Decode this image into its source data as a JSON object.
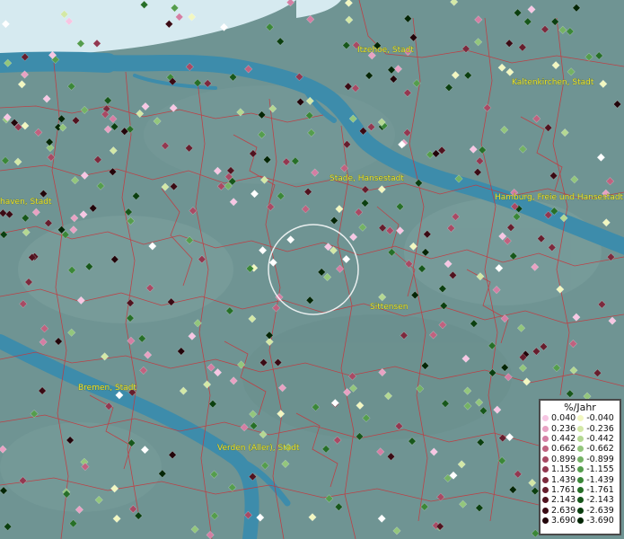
{
  "map": {
    "colors": {
      "land": "#6f9493",
      "water": "#3d8cab",
      "sea": "#d6eaf0",
      "border": "#c8343a",
      "marker_ring": "#ffffff",
      "label": "#e8e23a"
    },
    "cities": [
      {
        "name": "Itzehoe, Stadt"
      },
      {
        "name": "Kaltenkirchen, Stadt"
      },
      {
        "name": "Stade, Hansestadt"
      },
      {
        "name": "Hamburg, Freie und Hansestadt"
      },
      {
        "name": "haven, Stadt"
      },
      {
        "name": "Sittensen"
      },
      {
        "name": "Bremen, Stadt"
      },
      {
        "name": "Verden (Aller), Stadt"
      }
    ]
  },
  "legend": {
    "title": "%/Jahr",
    "positive": [
      {
        "label": "0.040",
        "color": "#f7c6e3"
      },
      {
        "label": "0.236",
        "color": "#e8a2c3"
      },
      {
        "label": "0.442",
        "color": "#d47ea3"
      },
      {
        "label": "0.662",
        "color": "#c0627f"
      },
      {
        "label": "0.899",
        "color": "#a84a64"
      },
      {
        "label": "1.155",
        "color": "#923850"
      },
      {
        "label": "1.439",
        "color": "#7c2a3d"
      },
      {
        "label": "1.761",
        "color": "#661e2d"
      },
      {
        "label": "2.143",
        "color": "#50131f"
      },
      {
        "label": "2.639",
        "color": "#3a0b14"
      },
      {
        "label": "3.690",
        "color": "#22050a"
      }
    ],
    "negative": [
      {
        "label": "-0.040",
        "color": "#f2f7c0"
      },
      {
        "label": "-0.236",
        "color": "#d3e8a6"
      },
      {
        "label": "-0.442",
        "color": "#b4d892"
      },
      {
        "label": "-0.662",
        "color": "#93c67c"
      },
      {
        "label": "-0.899",
        "color": "#74b264"
      },
      {
        "label": "-1.155",
        "color": "#559d4d"
      },
      {
        "label": "-1.439",
        "color": "#3b8738"
      },
      {
        "label": "-1.761",
        "color": "#276f28"
      },
      {
        "label": "-2.143",
        "color": "#17571b"
      },
      {
        "label": "-2.639",
        "color": "#0b3f10"
      },
      {
        "label": "-3.690",
        "color": "#042606"
      }
    ]
  }
}
